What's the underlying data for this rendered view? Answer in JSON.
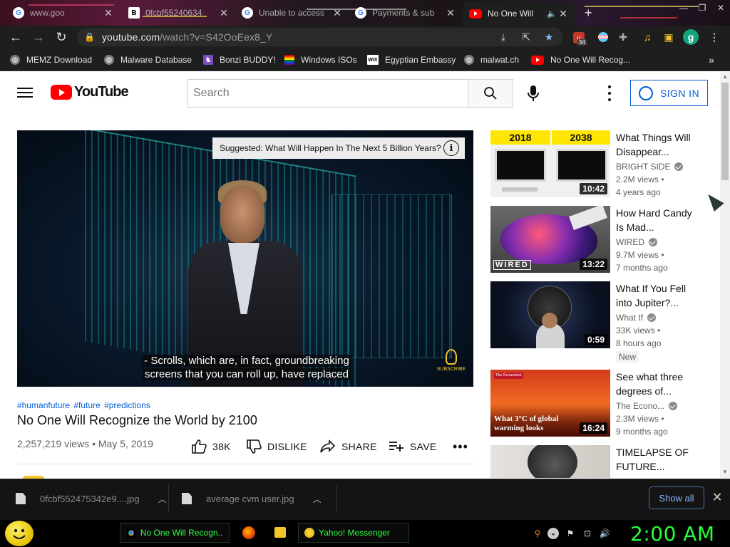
{
  "browser": {
    "tabs": [
      {
        "label": "www.goo",
        "icon": "google-icon"
      },
      {
        "label": "0fcbf55240634",
        "icon": "b-icon"
      },
      {
        "label": "Unable to access",
        "icon": "google-icon"
      },
      {
        "label": "Payments & sub",
        "icon": "google-icon"
      },
      {
        "label": "No One Will",
        "icon": "youtube-icon",
        "active": true
      }
    ],
    "url_domain": "youtube.com",
    "url_path": "/watch?v=S42OoEex8_Y",
    "extension_badge": "34",
    "profile_initial": "g",
    "bookmarks": [
      "MEMZ Download",
      "Malware Database",
      "Bonzi BUDDY!",
      "Windows ISOs",
      "Egyptian Embassy",
      "malwat.ch",
      "No One Will Recog..."
    ],
    "bookmarks_overflow": "»"
  },
  "youtube": {
    "logo_text": "YouTube",
    "search_placeholder": "Search",
    "signin_label": "SIGN IN"
  },
  "player": {
    "suggested": "Suggested: What Will Happen In The Next 5 Billion Years?",
    "caption_line1": "- Scrolls, which are, in fact, groundbreaking",
    "caption_line2": "screens that you can roll up, have replaced",
    "watermark": "SUBSCRIBE"
  },
  "video": {
    "hashtags": "#humanfuture #future #predictions",
    "title": "No One Will Recognize the World by 2100",
    "views": "2,257,219 views",
    "date": "May 5, 2019",
    "likes": "38K",
    "dislike_label": "DISLIKE",
    "share_label": "SHARE",
    "save_label": "SAVE"
  },
  "recommendations": [
    {
      "title": "What Things Will Disappear...",
      "channel": "BRIGHT SIDE",
      "views": "2.2M views •",
      "age": "4 years ago",
      "duration": "10:42",
      "thumb_labels": [
        "2018",
        "2038"
      ]
    },
    {
      "title": "How Hard Candy Is Mad...",
      "channel": "WIRED",
      "views": "9.7M views •",
      "age": "7 months ago",
      "duration": "13:22",
      "thumb_labels": [
        "WIRED"
      ]
    },
    {
      "title": "What If You Fell into Jupiter?...",
      "channel": "What If",
      "views": "33K views •",
      "age": "8 hours ago",
      "duration": "0:59",
      "badge": "New"
    },
    {
      "title": "See what three degrees of...",
      "channel": "The Econo...",
      "views": "2.3M views •",
      "age": "9 months ago",
      "duration": "16:24",
      "thumb_labels": [
        "The Economist",
        "What 3°C of global warming looks"
      ]
    },
    {
      "title": "TIMELAPSE OF FUTURE..."
    }
  ],
  "downloads": [
    {
      "name": "0fcbf552475342e9....jpg"
    },
    {
      "name": "average cvm user.jpg"
    }
  ],
  "downloads_show_all": "Show all",
  "taskbar": {
    "tasks": [
      {
        "label": "No One Will Recogn...",
        "icon": "chrome-icon"
      },
      {
        "label": "Yahoo! Messenger",
        "icon": "yahoo-messenger-icon"
      }
    ],
    "clock": "2:00 AM"
  },
  "colors": {
    "youtube_red": "#ff0000",
    "link_blue": "#065fd4",
    "clock_green": "#28ff3c",
    "browser_dark": "#1e1e1e"
  }
}
